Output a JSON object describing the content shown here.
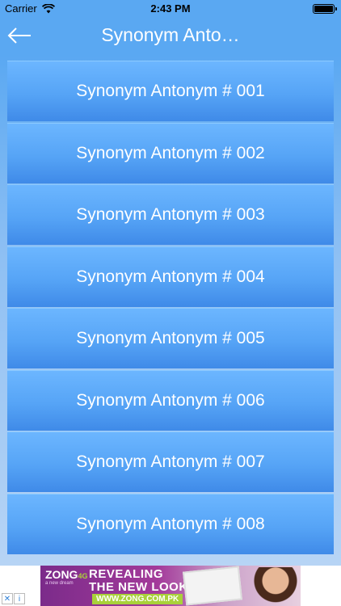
{
  "status_bar": {
    "carrier": "Carrier",
    "time": "2:43 PM"
  },
  "nav": {
    "title": "Synonym Anto…"
  },
  "list": {
    "items": [
      "Synonym Antonym # 001",
      "Synonym Antonym # 002",
      "Synonym Antonym # 003",
      "Synonym Antonym # 004",
      "Synonym Antonym # 005",
      "Synonym Antonym # 006",
      "Synonym Antonym # 007",
      "Synonym Antonym # 008"
    ]
  },
  "ad": {
    "logo": "ZONG",
    "logo_4g": "4G",
    "logo_sub": "a new dream",
    "line1": "REVEALING",
    "line2": "THE NEW LOOK!",
    "url": "WWW.ZONG.COM.PK",
    "close_glyph": "✕",
    "info_glyph": "i"
  },
  "colors": {
    "bar_blue": "#5aa8f2",
    "item_blue": "#56a4f6",
    "text_white": "#ffffff"
  }
}
